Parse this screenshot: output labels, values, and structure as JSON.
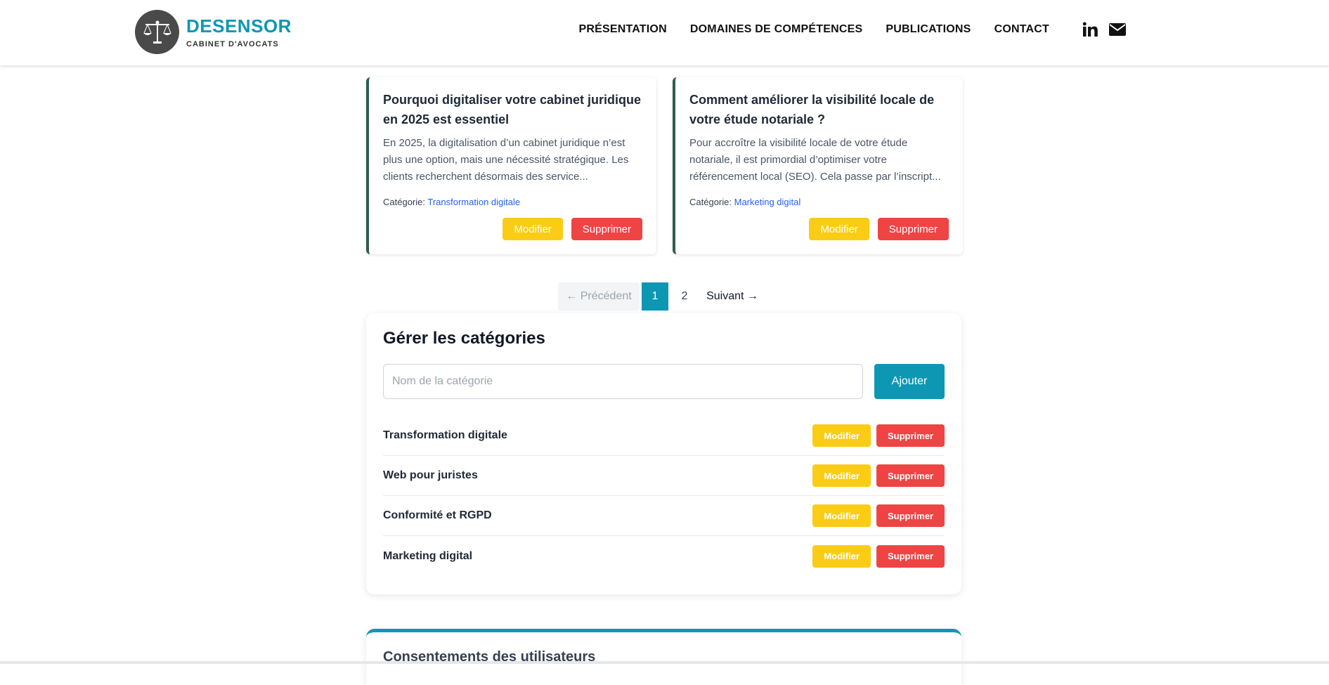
{
  "brand": {
    "name": "DESENSOR",
    "tagline": "CABINET D'AVOCATS"
  },
  "nav": {
    "items": [
      "PRÉSENTATION",
      "DOMAINES DE COMPÉTENCES",
      "PUBLICATIONS",
      "CONTACT"
    ],
    "icons": [
      "linkedin-icon",
      "mail-icon"
    ]
  },
  "articles": [
    {
      "title": "Pourquoi digitaliser votre cabinet juridique en 2025 est essentiel",
      "excerpt": "En 2025, la digitalisation d’un cabinet juridique n’est plus une option, mais une nécessité stratégique. Les clients recherchent désormais des service...",
      "category_label": "Catégorie:",
      "category": "Transformation digitale",
      "edit_label": "Modifier",
      "delete_label": "Supprimer"
    },
    {
      "title": "Comment améliorer la visibilité locale de votre étude notariale ?",
      "excerpt": "Pour accroître la visibilité locale de votre étude notariale, il est primordial d’optimiser votre référencement local (SEO). Cela passe par l’inscript...",
      "category_label": "Catégorie:",
      "category": "Marketing digital",
      "edit_label": "Modifier",
      "delete_label": "Supprimer"
    }
  ],
  "pagination": {
    "prev": "← Précédent",
    "pages": [
      "1",
      "2"
    ],
    "current": "1",
    "next": "Suivant →"
  },
  "categories_panel": {
    "title": "Gérer les catégories",
    "input_placeholder": "Nom de la catégorie",
    "add_label": "Ajouter",
    "edit_label": "Modifier",
    "delete_label": "Supprimer",
    "items": [
      "Transformation digitale",
      "Web pour juristes",
      "Conformité et RGPD",
      "Marketing digital"
    ]
  },
  "consents_panel": {
    "title": "Consentements des utilisateurs"
  },
  "colors": {
    "accent": "#0e97b3",
    "edit": "#facc15",
    "delete": "#ef4444",
    "link": "#2563eb"
  }
}
